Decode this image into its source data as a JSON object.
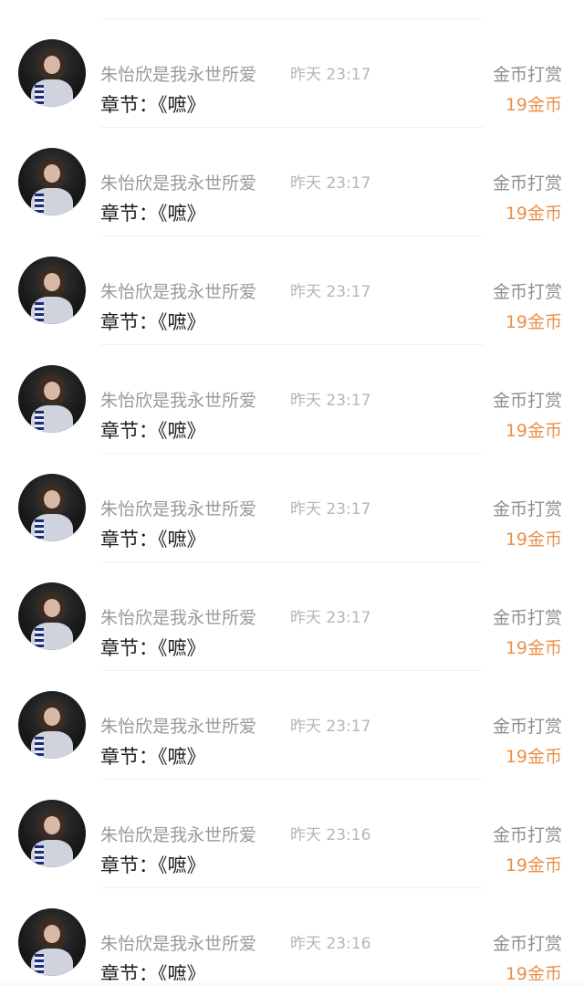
{
  "rows": [
    {
      "username": "朱怡欣是我永世所爱",
      "time": "昨天 23:17",
      "chapter": "章节：《嗻》",
      "action": "金币打赏",
      "amount": "19金币"
    },
    {
      "username": "朱怡欣是我永世所爱",
      "time": "昨天 23:17",
      "chapter": "章节：《嗻》",
      "action": "金币打赏",
      "amount": "19金币"
    },
    {
      "username": "朱怡欣是我永世所爱",
      "time": "昨天 23:17",
      "chapter": "章节：《嗻》",
      "action": "金币打赏",
      "amount": "19金币"
    },
    {
      "username": "朱怡欣是我永世所爱",
      "time": "昨天 23:17",
      "chapter": "章节：《嗻》",
      "action": "金币打赏",
      "amount": "19金币"
    },
    {
      "username": "朱怡欣是我永世所爱",
      "time": "昨天 23:17",
      "chapter": "章节：《嗻》",
      "action": "金币打赏",
      "amount": "19金币"
    },
    {
      "username": "朱怡欣是我永世所爱",
      "time": "昨天 23:17",
      "chapter": "章节：《嗻》",
      "action": "金币打赏",
      "amount": "19金币"
    },
    {
      "username": "朱怡欣是我永世所爱",
      "time": "昨天 23:17",
      "chapter": "章节：《嗻》",
      "action": "金币打赏",
      "amount": "19金币"
    },
    {
      "username": "朱怡欣是我永世所爱",
      "time": "昨天 23:16",
      "chapter": "章节：《嗻》",
      "action": "金币打赏",
      "amount": "19金币"
    },
    {
      "username": "朱怡欣是我永世所爱",
      "time": "昨天 23:16",
      "chapter": "章节：《嗻》",
      "action": "金币打赏",
      "amount": "19金币"
    }
  ],
  "colors": {
    "username": "#9a9a9a",
    "time": "#b6b6b6",
    "chapter": "#1f1f1f",
    "action": "#8f8f8f",
    "amount": "#e8914b",
    "separator": "#f1f1f1"
  }
}
